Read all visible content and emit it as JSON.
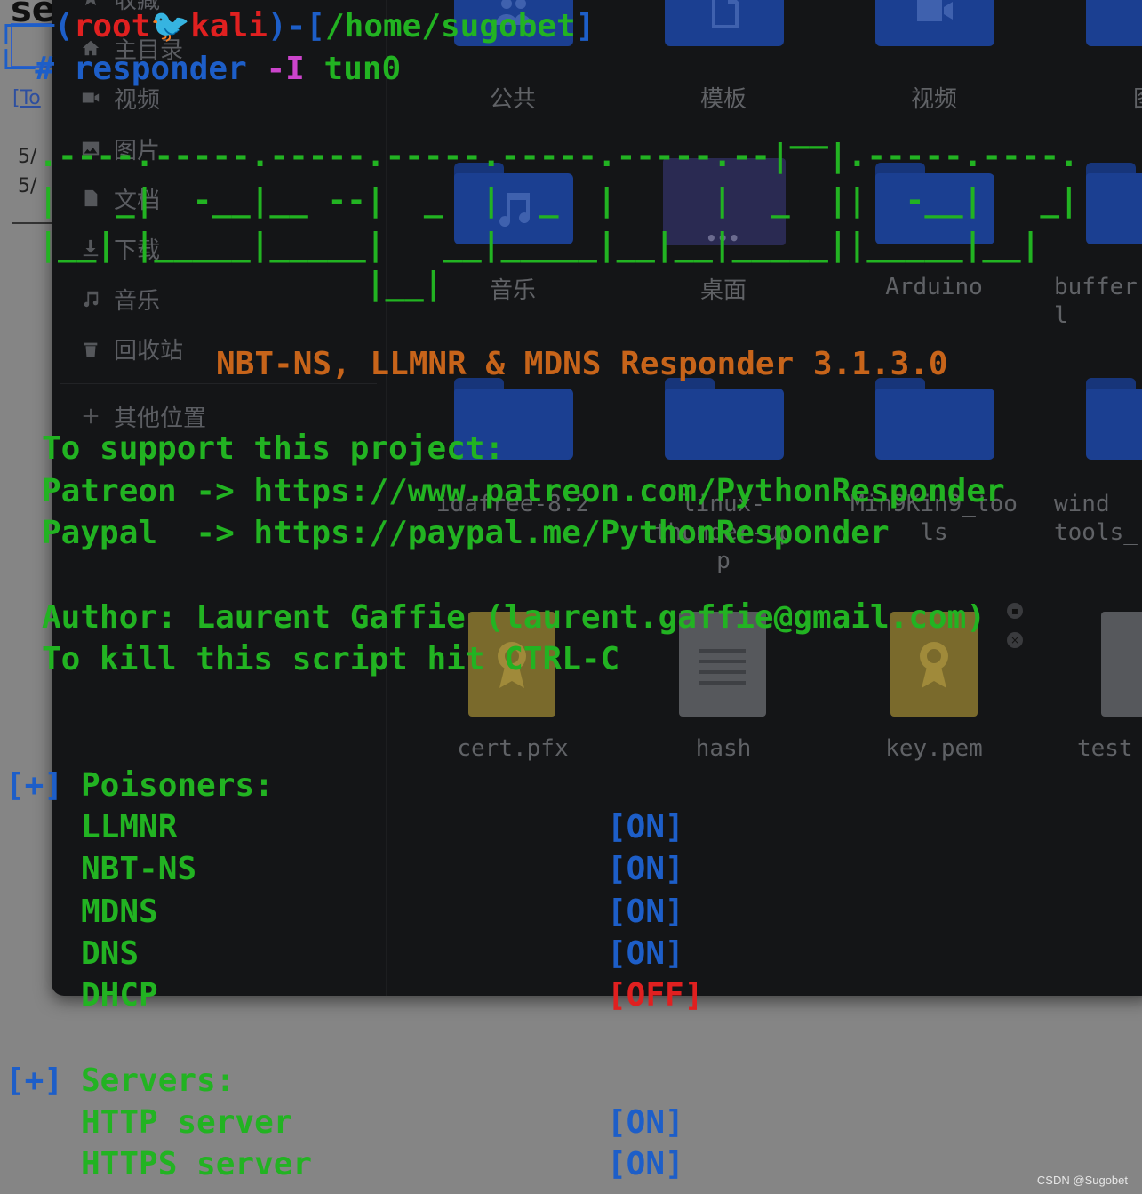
{
  "background_page": {
    "title": "se",
    "link": "[To",
    "dates": [
      "5/",
      "5/"
    ]
  },
  "file_manager": {
    "sidebar": {
      "items": [
        {
          "label": "收藏",
          "icon": "star-icon"
        },
        {
          "label": "主目录",
          "icon": "home-icon"
        },
        {
          "label": "视频",
          "icon": "video-icon"
        },
        {
          "label": "图片",
          "icon": "image-icon"
        },
        {
          "label": "文档",
          "icon": "document-icon"
        },
        {
          "label": "下载",
          "icon": "download-icon"
        },
        {
          "label": "音乐",
          "icon": "music-icon"
        },
        {
          "label": "回收站",
          "icon": "trash-icon"
        },
        {
          "label": "其他位置",
          "icon": "plus-icon"
        }
      ]
    },
    "tiles_row1": [
      "公共",
      "模板",
      "视频",
      "图"
    ],
    "tiles_row2": [
      "音乐",
      "桌面",
      "Arduino",
      "buffer\nl"
    ],
    "tiles_row3": [
      "idafree-8.2",
      "linux-\nthunder-up\np",
      "Min9Kin9_too\nls",
      "wind\ntools_"
    ],
    "tiles_row4": [
      "cert.pfx",
      "hash",
      "key.pem",
      "test"
    ]
  },
  "terminal": {
    "prompt_open": "┌──(",
    "user": "root",
    "at": "🐦",
    "host": "kali",
    "prompt_close": ")-[",
    "path": "/home/sugobet",
    "prompt_end": "]",
    "hash": "└─#",
    "command": "responder",
    "flag": "-I",
    "arg": "tun0",
    "banner": [
      "                                         __",
      "  .----.-----.-----.-----.-----.-----.--|  |.-----.----.",
      "  |   _|  -__|__ --|  _  |  _  |     |  _  ||  -__|   _|",
      "  |__| |_____|_____|   __|_____|__|__|_____||_____|__|",
      "                   |__|"
    ],
    "version_line": "NBT-NS, LLMNR & MDNS Responder 3.1.3.0",
    "support_title": "To support this project:",
    "patreon": "Patreon -> https://www.patreon.com/PythonResponder",
    "paypal": "Paypal  -> https://paypal.me/PythonResponder",
    "author": "Author: Laurent Gaffie (laurent.gaffie@gmail.com)",
    "kill": "To kill this script hit CTRL-C",
    "marker": "[+]",
    "poisoners_title": "Poisoners:",
    "poisoners": [
      {
        "name": "LLMNR",
        "status": "[ON]"
      },
      {
        "name": "NBT-NS",
        "status": "[ON]"
      },
      {
        "name": "MDNS",
        "status": "[ON]"
      },
      {
        "name": "DNS",
        "status": "[ON]"
      },
      {
        "name": "DHCP",
        "status": "[OFF]"
      }
    ],
    "servers_title": "Servers:",
    "servers": [
      {
        "name": "HTTP server",
        "status": "[ON]"
      },
      {
        "name": "HTTPS server",
        "status": "[ON]"
      }
    ]
  },
  "watermark": "CSDN @Sugobet",
  "colors": {
    "green": "#22b322",
    "blue": "#1d5ec8",
    "red": "#e02020",
    "magenta": "#cc44cc",
    "orange": "#c7641a"
  }
}
